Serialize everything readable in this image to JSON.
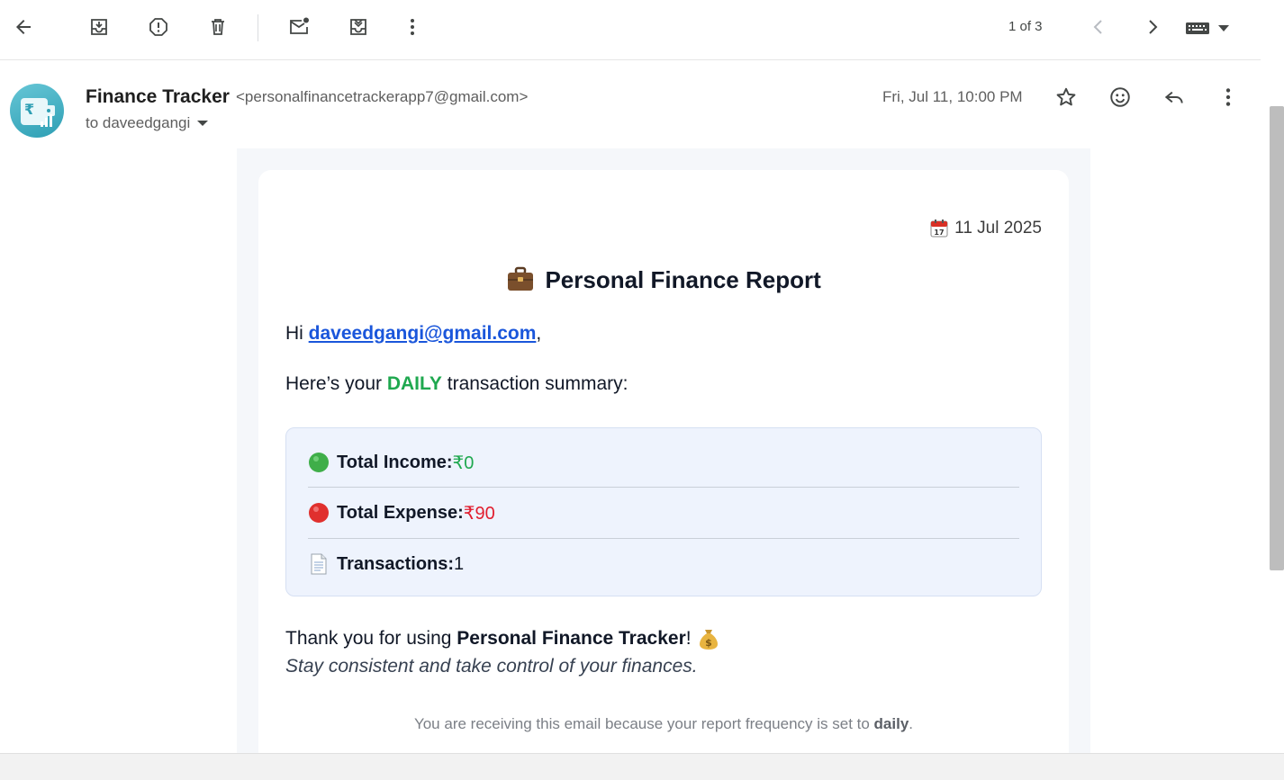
{
  "toolbar": {
    "pager_text": "1 of 3"
  },
  "header": {
    "sender_name": "Finance Tracker",
    "sender_email": "<personalfinancetrackerapp7@gmail.com>",
    "to_text": "to daveedgangi",
    "date_text": "Fri, Jul 11, 10:00 PM"
  },
  "email": {
    "report_date": "11 Jul 2025",
    "title": "Personal Finance Report",
    "greeting_prefix": "Hi ",
    "recipient_link": "daveedgangi@gmail.com",
    "greeting_suffix": ",",
    "intro_prefix": "Here’s your ",
    "intro_frequency": "DAILY",
    "intro_suffix": " transaction summary:",
    "summary": {
      "income_label": "Total Income:",
      "income_value": "₹0",
      "expense_label": "Total Expense:",
      "expense_value": "₹90",
      "transactions_label": "Transactions:",
      "transactions_value": "1"
    },
    "thanks_prefix": "Thank you for using ",
    "thanks_app": "Personal Finance Tracker",
    "thanks_suffix": "!",
    "tagline": "Stay consistent and take control of your finances.",
    "footer_prefix": "You are receiving this email because your report frequency is set to ",
    "footer_frequency": "daily",
    "footer_suffix": "."
  },
  "colors": {
    "income_green": "#1fa84f",
    "expense_red": "#e11d2e",
    "link_blue": "#1a56db",
    "summary_bg": "#eef3fd"
  },
  "icons": [
    "back-arrow-icon",
    "archive-icon",
    "report-spam-icon",
    "delete-icon",
    "mark-unread-icon",
    "move-to-icon",
    "more-vert-icon",
    "chevron-left-icon",
    "chevron-right-icon",
    "keyboard-icon",
    "star-icon",
    "emoji-icon",
    "reply-icon",
    "calendar-icon",
    "briefcase-icon",
    "green-circle-icon",
    "red-circle-icon",
    "page-icon",
    "money-bag-icon"
  ]
}
